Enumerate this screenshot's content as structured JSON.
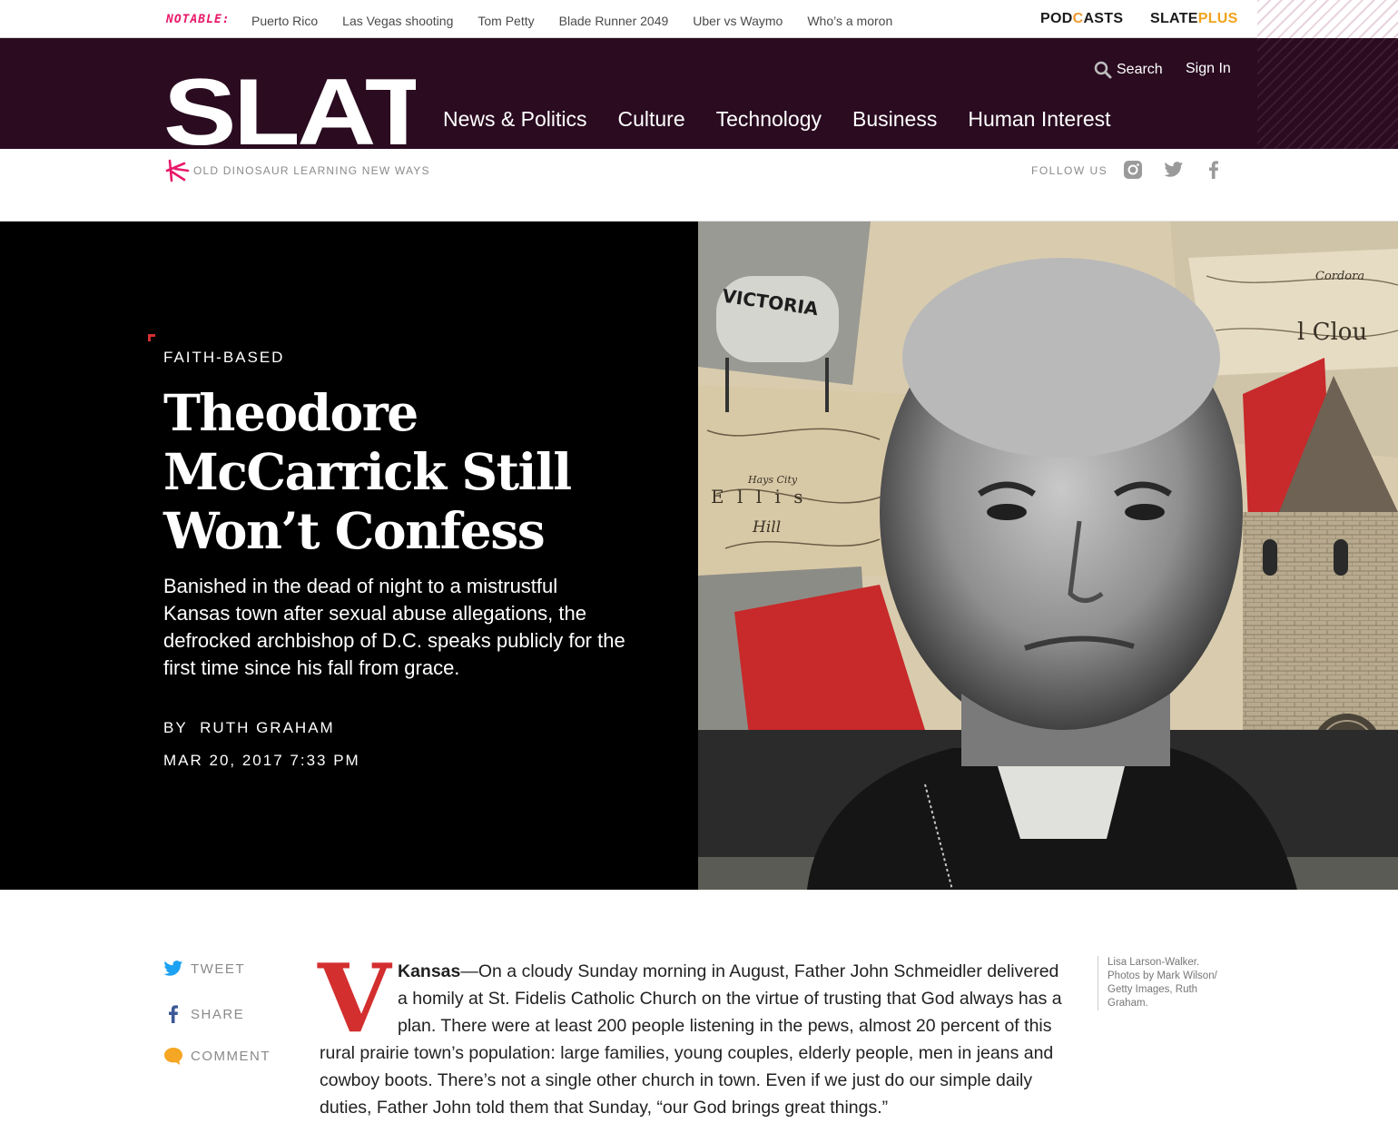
{
  "notable": {
    "label": "NOTABLE:",
    "links": [
      "Puerto Rico",
      "Las Vegas shooting",
      "Tom Petty",
      "Blade Runner 2049",
      "Uber vs Waymo",
      "Who’s a moron"
    ]
  },
  "promos": {
    "podcasts_pre": "POD",
    "podcasts_c": "C",
    "podcasts_post": "ASTS",
    "slate": "SLATE",
    "plus": "PLUS"
  },
  "header": {
    "logo": "SLATE",
    "nav": [
      "News & Politics",
      "Culture",
      "Technology",
      "Business",
      "Human Interest"
    ],
    "search_label": "Search",
    "signin_label": "Sign In"
  },
  "subheader": {
    "tagline": "OLD DINOSAUR LEARNING NEW WAYS",
    "follow_label": "FOLLOW US",
    "social_icons": [
      "instagram-icon",
      "twitter-icon",
      "facebook-icon"
    ]
  },
  "article": {
    "kicker": "FAITH-BASED",
    "headline": "Theodore McCarrick Still Won’t Confess",
    "dek": "Banished in the dead of night to a mistrustful Kansas town after sexual abuse allegations, the defrocked archbishop of D.C. speaks publicly for the first time since his fall from grace.",
    "byline_prefix": "BY",
    "author": "RUTH GRAHAM",
    "date": "MAR 20, 2017 7:33 PM",
    "dropcap": "V",
    "dateline": "Kansas",
    "body": "—On a cloudy Sunday morning in August, Father John Schmeidler delivered a homily at St. Fidelis Catholic Church on the virtue of trusting that God always has a plan. There were at least 200 people listening in the pews, almost 20 percent of this rural prairie town’s population: large families, young couples, elderly people, men in jeans and cowboy boots. There’s not a single other church in town. Even if we just do our simple daily duties, Father John told them that Sunday, “our God brings great things.”",
    "caption": "Lisa Larson-Walker. Photos by Mark Wilson/ Getty Images, Ruth Graham."
  },
  "share": {
    "tweet": "TWEET",
    "share": "SHARE",
    "comment": "COMMENT"
  },
  "colors": {
    "header_bg": "#2a0b20",
    "notable_pink": "#e8196a",
    "accent_red": "#d32f2f",
    "plus_gold": "#f2a31b"
  }
}
